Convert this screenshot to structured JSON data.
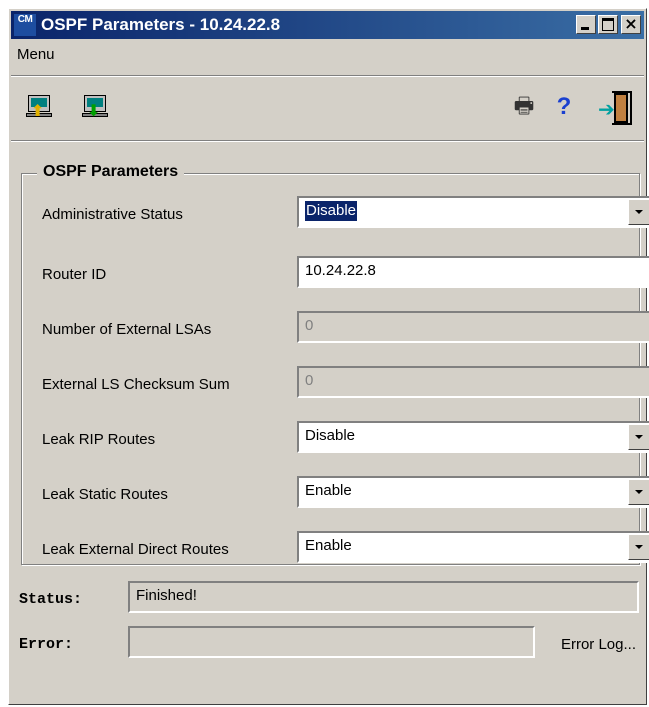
{
  "window": {
    "title": "OSPF Parameters - 10.24.22.8",
    "icon_top": "CM",
    "icon_bottom": "CM"
  },
  "menu": {
    "label": "Menu"
  },
  "toolbar": {
    "buttons": [
      "upload-icon",
      "download-icon",
      "printer-icon",
      "help-icon",
      "exit-icon"
    ],
    "help_glyph": "?"
  },
  "group": {
    "title": "OSPF Parameters",
    "fields": {
      "admin_status": {
        "label": "Administrative Status",
        "value": "Disable"
      },
      "router_id": {
        "label": "Router ID",
        "value": "10.24.22.8"
      },
      "num_ext_lsas": {
        "label": "Number of External LSAs",
        "value": "0"
      },
      "ext_ls_checksum": {
        "label": "External LS Checksum Sum",
        "value": "0"
      },
      "leak_rip": {
        "label": "Leak RIP Routes",
        "value": "Disable"
      },
      "leak_static": {
        "label": "Leak Static Routes",
        "value": "Enable"
      },
      "leak_ext_direct": {
        "label": "Leak External Direct Routes",
        "value": "Enable"
      }
    }
  },
  "status": {
    "label": "Status:",
    "value": "Finished!"
  },
  "error": {
    "label": "Error:",
    "value": "",
    "log_link": "Error Log..."
  },
  "colors": {
    "titlebar": "#0a246a",
    "face": "#d4d0c8",
    "selection": "#0a246a"
  }
}
